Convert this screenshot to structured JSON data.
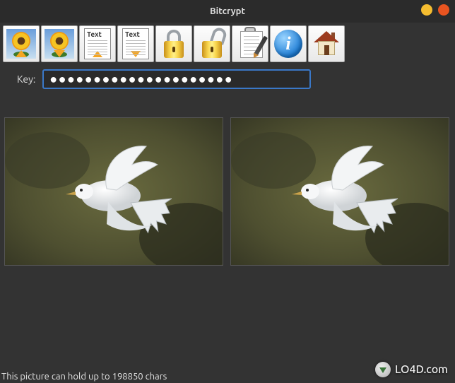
{
  "window": {
    "title": "Bitcrypt"
  },
  "toolbar": {
    "items": [
      {
        "name": "load-image-button",
        "icon": "sunflower-up-icon"
      },
      {
        "name": "save-image-button",
        "icon": "sunflower-down-icon"
      },
      {
        "name": "load-text-button",
        "icon": "text-load-icon"
      },
      {
        "name": "save-text-button",
        "icon": "text-save-icon"
      },
      {
        "name": "encrypt-button",
        "icon": "padlock-closed-icon"
      },
      {
        "name": "decrypt-button",
        "icon": "padlock-open-icon"
      },
      {
        "name": "edit-text-button",
        "icon": "compose-icon"
      },
      {
        "name": "about-button",
        "icon": "info-icon"
      },
      {
        "name": "home-button",
        "icon": "home-icon"
      }
    ]
  },
  "key": {
    "label": "Key:",
    "value": "●●●●●●●●●●●●●●●●●●●●●"
  },
  "status": {
    "text": "This picture can hold up to 198850 chars"
  },
  "watermark": {
    "text": "LO4D.com"
  }
}
